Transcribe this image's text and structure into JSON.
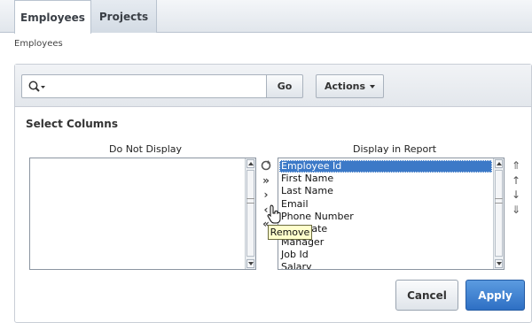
{
  "tabs": [
    {
      "label": "Employees",
      "active": true
    },
    {
      "label": "Projects",
      "active": false
    }
  ],
  "breadcrumb": "Employees",
  "search": {
    "value": "",
    "placeholder": ""
  },
  "toolbar": {
    "go_label": "Go",
    "actions_label": "Actions"
  },
  "select_columns": {
    "title": "Select Columns",
    "do_not_display_label": "Do Not Display",
    "display_in_report_label": "Display in Report",
    "do_not_display_items": [],
    "display_in_report_items": [
      {
        "label": "Employee Id",
        "selected": true
      },
      {
        "label": "First Name",
        "selected": false
      },
      {
        "label": "Last Name",
        "selected": false
      },
      {
        "label": "Email",
        "selected": false
      },
      {
        "label": "Phone Number",
        "selected": false
      },
      {
        "label": "Hire Date",
        "selected": false
      },
      {
        "label": "Manager",
        "selected": false
      },
      {
        "label": "Job Id",
        "selected": false
      },
      {
        "label": "Salary",
        "selected": false
      }
    ]
  },
  "tooltip": "Remove",
  "buttons": {
    "cancel": "Cancel",
    "apply": "Apply"
  },
  "colors": {
    "accent": "#3c79c7",
    "apply": "#2e6fc4",
    "tooltip_bg": "#ffffcc"
  }
}
